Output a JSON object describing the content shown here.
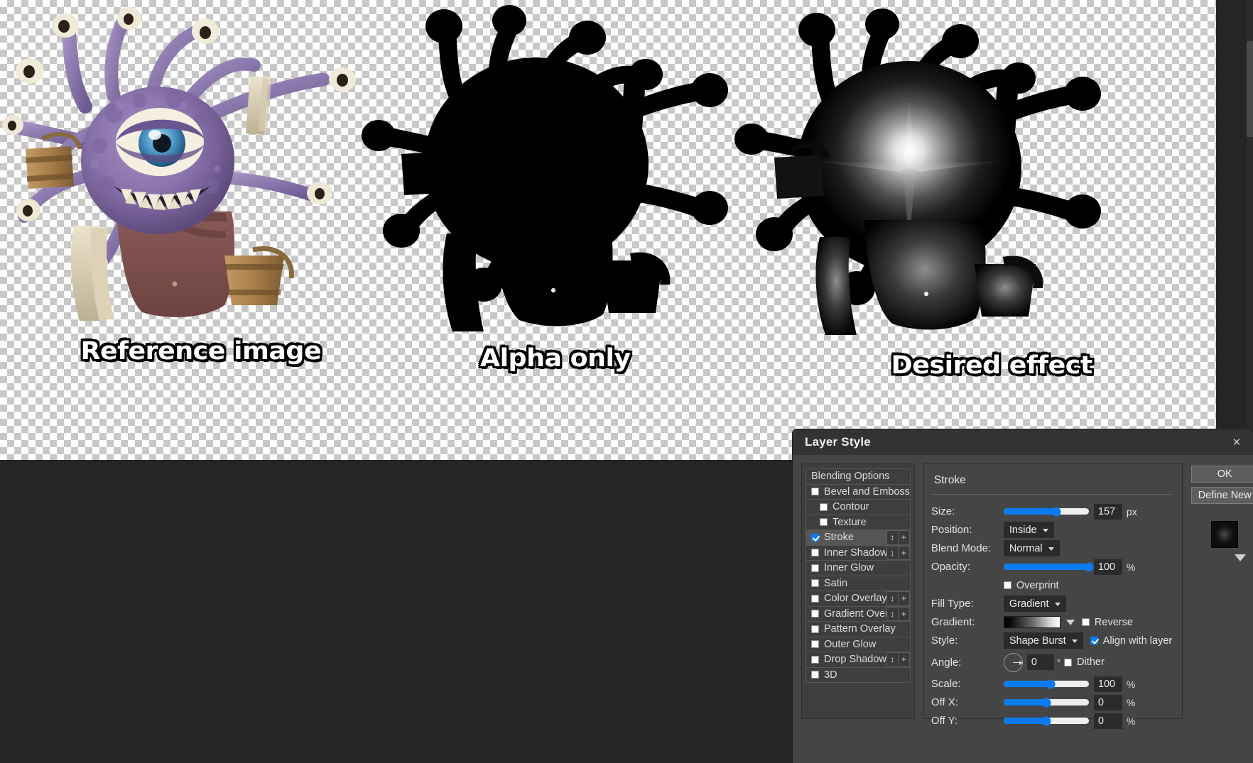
{
  "canvas": {
    "figures": [
      {
        "label": "Reference image",
        "kind": "reference-beholder"
      },
      {
        "label": "Alpha only",
        "kind": "alpha-silhouette"
      },
      {
        "label": "Desired effect",
        "kind": "shape-burst-stroke"
      }
    ]
  },
  "dialog": {
    "title": "Layer Style",
    "close_label": "×",
    "effects": {
      "header": "Blending Options",
      "items": [
        {
          "label": "Bevel and Emboss",
          "checked": false,
          "indent": false,
          "selected": false,
          "has_buttons": false
        },
        {
          "label": "Contour",
          "checked": false,
          "indent": true,
          "selected": false,
          "has_buttons": false
        },
        {
          "label": "Texture",
          "checked": false,
          "indent": true,
          "selected": false,
          "has_buttons": false
        },
        {
          "label": "Stroke",
          "checked": true,
          "indent": false,
          "selected": true,
          "has_buttons": true
        },
        {
          "label": "Inner Shadow",
          "checked": false,
          "indent": false,
          "selected": false,
          "has_buttons": true
        },
        {
          "label": "Inner Glow",
          "checked": false,
          "indent": false,
          "selected": false,
          "has_buttons": false
        },
        {
          "label": "Satin",
          "checked": false,
          "indent": false,
          "selected": false,
          "has_buttons": false
        },
        {
          "label": "Color Overlay",
          "checked": false,
          "indent": false,
          "selected": false,
          "has_buttons": true
        },
        {
          "label": "Gradient Overlay",
          "checked": false,
          "indent": false,
          "selected": false,
          "has_buttons": true
        },
        {
          "label": "Pattern Overlay",
          "checked": false,
          "indent": false,
          "selected": false,
          "has_buttons": false
        },
        {
          "label": "Outer Glow",
          "checked": false,
          "indent": false,
          "selected": false,
          "has_buttons": false
        },
        {
          "label": "Drop Shadow",
          "checked": false,
          "indent": false,
          "selected": false,
          "has_buttons": true
        },
        {
          "label": "3D",
          "checked": false,
          "indent": false,
          "selected": false,
          "has_buttons": false
        }
      ],
      "reorder_icon": "↕",
      "add_icon": "+"
    },
    "settings": {
      "title": "Stroke",
      "size": {
        "label": "Size:",
        "value": "157",
        "unit": "px",
        "percent": 62
      },
      "position": {
        "label": "Position:",
        "value": "Inside"
      },
      "blend_mode": {
        "label": "Blend Mode:",
        "value": "Normal"
      },
      "opacity": {
        "label": "Opacity:",
        "value": "100",
        "unit": "%",
        "percent": 100
      },
      "overprint": {
        "label": "Overprint",
        "checked": false
      },
      "fill_type": {
        "label": "Fill Type:",
        "value": "Gradient"
      },
      "gradient": {
        "label": "Gradient:",
        "reverse_label": "Reverse",
        "reverse_checked": false,
        "from": "#000000",
        "to": "#ffffff"
      },
      "style": {
        "label": "Style:",
        "value": "Shape Burst",
        "align_label": "Align with layer",
        "align_checked": true
      },
      "angle": {
        "label": "Angle:",
        "value": "0",
        "unit": "°",
        "dither_label": "Dither",
        "dither_checked": false
      },
      "scale": {
        "label": "Scale:",
        "value": "100",
        "unit": "%",
        "percent": 55
      },
      "off_x": {
        "label": "Off X:",
        "value": "0",
        "unit": "%",
        "percent": 50
      },
      "off_y": {
        "label": "Off Y:",
        "value": "0",
        "unit": "%",
        "percent": 50
      }
    },
    "actions": {
      "ok": "OK",
      "define_new": "Define New"
    }
  },
  "colors": {
    "accent": "#0b7cf0",
    "dialog_bg": "#454545",
    "titlebar_bg": "#333333",
    "panel_bg": "#3e3e3e",
    "field_bg": "#2b2b2b",
    "app_bg": "#252525",
    "checker_light": "#ffffff",
    "checker_dark": "#c8c8c8"
  }
}
